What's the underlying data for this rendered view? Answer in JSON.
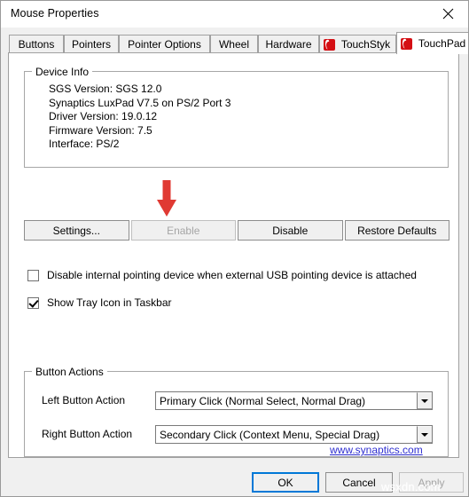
{
  "window": {
    "title": "Mouse Properties",
    "close_icon": "close-icon"
  },
  "tabs": [
    {
      "label": "Buttons",
      "icon": null,
      "selected": false
    },
    {
      "label": "Pointers",
      "icon": null,
      "selected": false
    },
    {
      "label": "Pointer Options",
      "icon": null,
      "selected": false
    },
    {
      "label": "Wheel",
      "icon": null,
      "selected": false
    },
    {
      "label": "Hardware",
      "icon": null,
      "selected": false
    },
    {
      "label": "TouchStyk",
      "icon": "synaptics-logo-icon",
      "selected": false
    },
    {
      "label": "TouchPad",
      "icon": "synaptics-logo-icon",
      "selected": true
    }
  ],
  "device_info": {
    "legend": "Device Info",
    "lines": [
      "SGS Version: SGS 12.0",
      "Synaptics LuxPad V7.5 on PS/2 Port 3",
      "Driver Version: 19.0.12",
      "Firmware Version: 7.5",
      "Interface: PS/2"
    ]
  },
  "annotation": {
    "arrow_color": "#e03a33",
    "points_at": "Enable"
  },
  "device_buttons": [
    {
      "label": "Settings...",
      "disabled": false
    },
    {
      "label": "Enable",
      "disabled": true
    },
    {
      "label": "Disable",
      "disabled": false
    },
    {
      "label": "Restore Defaults",
      "disabled": false
    }
  ],
  "checkboxes": [
    {
      "label": "Disable internal pointing device when external USB pointing device is attached",
      "checked": false
    },
    {
      "label": "Show Tray Icon in Taskbar",
      "checked": true
    }
  ],
  "button_actions": {
    "legend": "Button Actions",
    "rows": [
      {
        "label": "Left Button Action",
        "value": "Primary Click (Normal Select, Normal Drag)"
      },
      {
        "label": "Right Button Action",
        "value": "Secondary Click (Context Menu, Special Drag)"
      }
    ]
  },
  "link": {
    "text": "www.synaptics.com",
    "color": "#2f2fd0"
  },
  "footer": {
    "ok": "OK",
    "cancel": "Cancel",
    "apply": "Apply",
    "accent": "#0078d7"
  },
  "watermark": {
    "text": "wsxdn.com"
  }
}
